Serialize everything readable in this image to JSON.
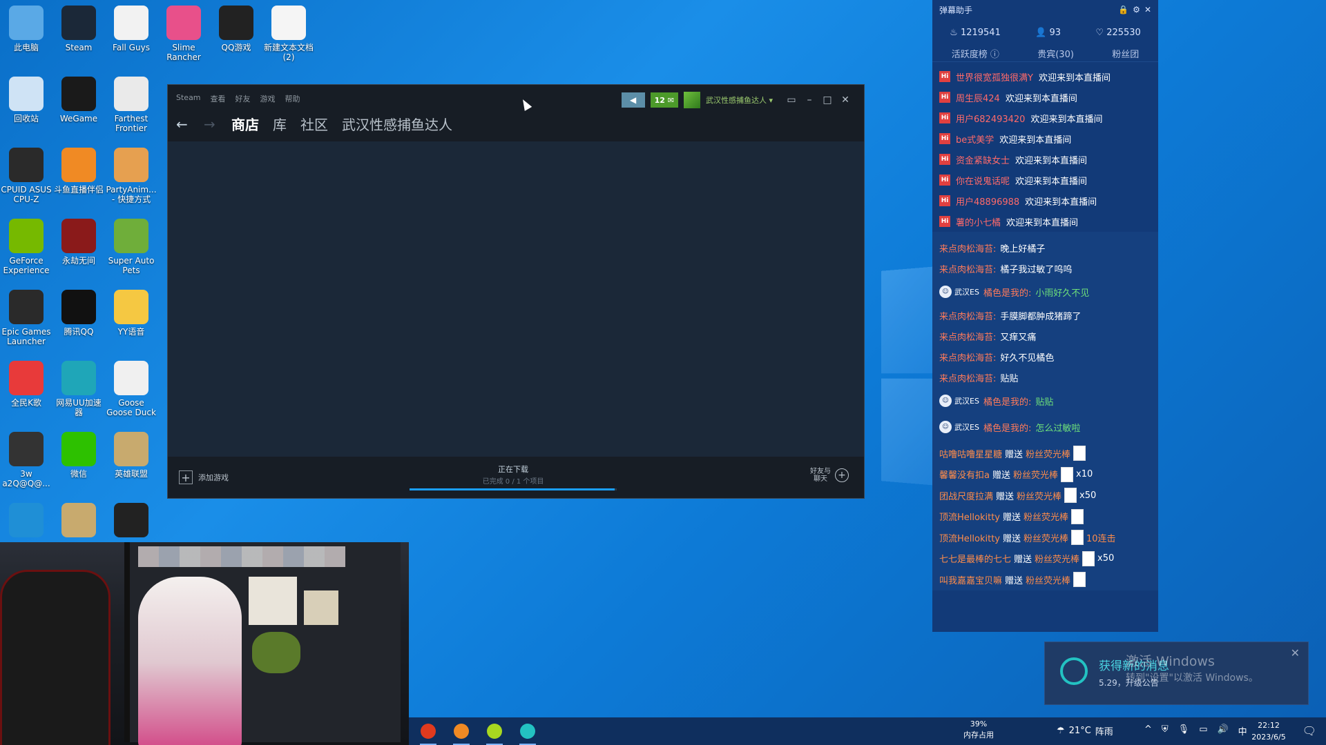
{
  "desktop": {
    "icons": [
      {
        "label": "此电脑",
        "icon": "computer-icon",
        "color": "#5aa9e6"
      },
      {
        "label": "Steam",
        "icon": "steam-icon",
        "color": "#1b2838"
      },
      {
        "label": "Fall Guys",
        "icon": "file-icon",
        "color": "#f2f2f2"
      },
      {
        "label": "Slime Rancher",
        "icon": "slime-icon",
        "color": "#e8508a"
      },
      {
        "label": "QQ游戏",
        "icon": "qq-penguin-icon",
        "color": "#222222"
      },
      {
        "label": "新建文本文档 (2)",
        "icon": "text-file-icon",
        "color": "#f5f5f5"
      },
      {
        "label": "回收站",
        "icon": "recycle-bin-icon",
        "color": "#cfe3f5"
      },
      {
        "label": "WeGame",
        "icon": "wegame-icon",
        "color": "#1a1a1a"
      },
      {
        "label": "Farthest Frontier",
        "icon": "ff-icon",
        "color": "#eaeaea"
      },
      {
        "label": "CPUID ASUS CPU-Z",
        "icon": "cpuz-icon",
        "color": "#2a2a2a"
      },
      {
        "label": "斗鱼直播伴侣",
        "icon": "douyu-icon",
        "color": "#f08a24"
      },
      {
        "label": "PartyAnim... - 快捷方式",
        "icon": "corgi-icon",
        "color": "#e6a050"
      },
      {
        "label": "GeForce Experience",
        "icon": "nvidia-icon",
        "color": "#76b900"
      },
      {
        "label": "永劫无间",
        "icon": "naraka-icon",
        "color": "#8a1a1a"
      },
      {
        "label": "Super Auto Pets",
        "icon": "turtle-icon",
        "color": "#6fae3a"
      },
      {
        "label": "Epic Games Launcher",
        "icon": "epic-icon",
        "color": "#2a2a2a"
      },
      {
        "label": "腾讯QQ",
        "icon": "qq-icon",
        "color": "#111111"
      },
      {
        "label": "YY语音",
        "icon": "yy-icon",
        "color": "#f5c842"
      },
      {
        "label": "全民K歌",
        "icon": "karaoke-icon",
        "color": "#e83a3a"
      },
      {
        "label": "网易UU加速器",
        "icon": "uu-icon",
        "color": "#1fa6b8"
      },
      {
        "label": "Goose Goose Duck",
        "icon": "goose-icon",
        "color": "#f0f0f0"
      },
      {
        "label": "3w a2Q@Q@...",
        "icon": "app-icon",
        "color": "#333333"
      },
      {
        "label": "微信",
        "icon": "wechat-icon",
        "color": "#2dc100"
      },
      {
        "label": "英雄联盟",
        "icon": "lol-icon",
        "color": "#c8aa6e"
      },
      {
        "label": "",
        "icon": "edge-icon",
        "color": "#1f8fd6"
      },
      {
        "label": "",
        "icon": "lol-client-icon",
        "color": "#c8aa6e"
      },
      {
        "label": "",
        "icon": "obs-icon",
        "color": "#222222"
      }
    ]
  },
  "steam": {
    "menu": [
      "Steam",
      "查看",
      "好友",
      "游戏",
      "帮助"
    ],
    "nav_tabs": [
      "商店",
      "库",
      "社区",
      "武汉性感捕鱼达人"
    ],
    "notif_count": "12 ✉",
    "account": "武汉性感捕鱼达人",
    "add_game": "添加游戏",
    "download_title": "正在下载",
    "download_sub": "已完成 0 / 1 个项目",
    "download_progress": 0.99,
    "friends_line1": "好友与",
    "friends_line2": "聊天"
  },
  "danmaku": {
    "title": "弹幕助手",
    "stats": {
      "heat": "1219541",
      "viewers": "93",
      "likes": "225530"
    },
    "tabs": [
      "活跃度榜",
      "贵宾(30)",
      "粉丝团"
    ],
    "welcome_tag": "Hi",
    "welcome_msg": "欢迎来到本直播间",
    "welcome_users": [
      "世界很宽孤独很满Y",
      "周生辰424",
      "用户682493420",
      "be式美学",
      "资金紧缺女士",
      "你在说鬼话呢",
      "用户48896988",
      "薯的小七橘"
    ],
    "chat": [
      {
        "user": "来点肉松海苔:",
        "msg": "晚上好橘子"
      },
      {
        "user": "来点肉松海苔:",
        "msg": "橘子我过敏了呜呜"
      },
      {
        "badge": "武汉ES",
        "user": "橘色是我的:",
        "msg": "小雨好久不见",
        "green": true
      },
      {
        "user": "来点肉松海苔:",
        "msg": "手膜脚都肿成猪蹄了"
      },
      {
        "user": "来点肉松海苔:",
        "msg": "又痒又痛"
      },
      {
        "user": "来点肉松海苔:",
        "msg": "好久不见橘色"
      },
      {
        "user": "来点肉松海苔:",
        "msg": "贴贴"
      },
      {
        "badge": "武汉ES",
        "user": "橘色是我的:",
        "msg": "贴贴",
        "green": true
      },
      {
        "badge": "武汉ES",
        "user": "橘色是我的:",
        "msg": "怎么过敏啦",
        "green": true
      }
    ],
    "gift_verb": "赠送",
    "gift_name": "粉丝荧光棒",
    "gifts": [
      {
        "user": "咕噜咕噜星星糖",
        "count": ""
      },
      {
        "user": "馨馨没有扣a",
        "count": "x10"
      },
      {
        "user": "团战尺度拉满",
        "count": "x50"
      },
      {
        "user": "顶流Hellokitty",
        "count": ""
      },
      {
        "user": "顶流Hellokitty",
        "count": "10连击",
        "orange": true
      },
      {
        "user": "七七是最棒的七七",
        "count": "x50"
      },
      {
        "user": "叫我嘉嘉宝贝嘛",
        "count": ""
      }
    ]
  },
  "toast": {
    "title": "获得新的消息",
    "sub": "5.29，升级公告",
    "activate_title": "激活 Windows",
    "activate_sub": "转到\"设置\"以激活 Windows。"
  },
  "taskbar": {
    "apps": [
      {
        "icon": "ea-icon",
        "color": "#e03a1e"
      },
      {
        "icon": "douyu-taskbar-icon",
        "color": "#f08a24"
      },
      {
        "icon": "ball-icon",
        "color": "#a8d820"
      },
      {
        "icon": "uu-taskbar-icon",
        "color": "#23c2c2"
      }
    ],
    "mem_pct": "39%",
    "mem_label": "内存占用",
    "weather_temp": "21°C",
    "weather_desc": "阵雨",
    "ime": "中",
    "time": "22:12",
    "date": "2023/6/5"
  }
}
